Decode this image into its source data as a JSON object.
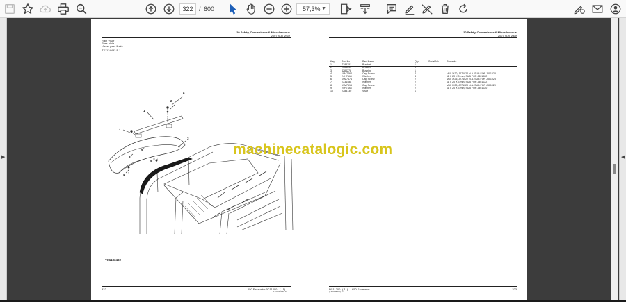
{
  "toolbar": {
    "page_current": "322",
    "page_separator": "/",
    "page_total": "600",
    "zoom": "57,3%"
  },
  "left_page": {
    "header_right_line1": "20 Safety, Convenience & Miscellaneous",
    "header_right_line2": "2007 Sun Visor",
    "title_lines": [
      "Rain Visor",
      "Pare-pluie",
      "Visera para lluvia"
    ],
    "figure_ref": "TX1134492 B 1",
    "callouts": [
      "1",
      "2",
      "3",
      "4",
      "5",
      "6",
      "7",
      "8",
      "9"
    ],
    "figure_caption": "TX1133492",
    "footer_page": "322",
    "footer_model": "650 Excavator",
    "footer_code": "PC11200",
    "footer_rev": "(-11)",
    "footer_sub": "(17Y0366W) 11"
  },
  "right_page": {
    "header_right_line1": "20 Safety, Convenience & Miscellaneous",
    "header_right_line2": "2007 Sun Visor",
    "table_headers": [
      "Key",
      "Part No.",
      "Part Name",
      "Qty",
      "Serial No.",
      "Remarks"
    ],
    "rows": [
      {
        "key": "1",
        "part": "T284251",
        "name": "Bracket",
        "qty": "1",
        "serial": "",
        "remarks": ""
      },
      {
        "key": "2",
        "part": "T284250",
        "name": "Bracket",
        "qty": "1",
        "serial": "",
        "remarks": ""
      },
      {
        "key": "3",
        "part": "4284278",
        "name": "Bushing",
        "qty": "1",
        "serial": "",
        "remarks": ""
      },
      {
        "key": "4",
        "part": "19M7462",
        "name": "Cap Screw",
        "qty": "4",
        "serial": "",
        "remarks": "M10 X 20, J271022 N.A. SUB FOR J301023"
      },
      {
        "key": "5",
        "part": "24H7348",
        "name": "Washer",
        "qty": "4",
        "serial": "",
        "remarks": "11 X 20 X 3 mm, SUB FOR J301022"
      },
      {
        "key": "6",
        "part": "19M7474",
        "name": "Cap Screw",
        "qty": "2",
        "serial": "",
        "remarks": "M10 X 25, J271022 N.A. SUB FOR J301023"
      },
      {
        "key": "7",
        "part": "T231488",
        "name": "Washer",
        "qty": "2",
        "serial": "",
        "remarks": "11 X 20 X 3 mm, SUB FOR J301022"
      },
      {
        "key": "8",
        "part": "19M7516",
        "name": "Cap Screw",
        "qty": "2",
        "serial": "",
        "remarks": "M10 X 20, J271020 N.A. SUB FOR J301020"
      },
      {
        "key": "9",
        "part": "24H7348",
        "name": "Washer",
        "qty": "2",
        "serial": "",
        "remarks": "11 X 20 X 3 mm, SUB FOR J301020"
      },
      {
        "key": "10",
        "part": "Z284130",
        "name": "Visor",
        "qty": "1",
        "serial": "",
        "remarks": ""
      }
    ],
    "footer_code": "PC11200",
    "footer_rev": "(-11)",
    "footer_model": "650 Excavator",
    "footer_sub": "(17Y0366W) 11",
    "footer_page": "323"
  },
  "watermark": "machinecatalogic.com"
}
